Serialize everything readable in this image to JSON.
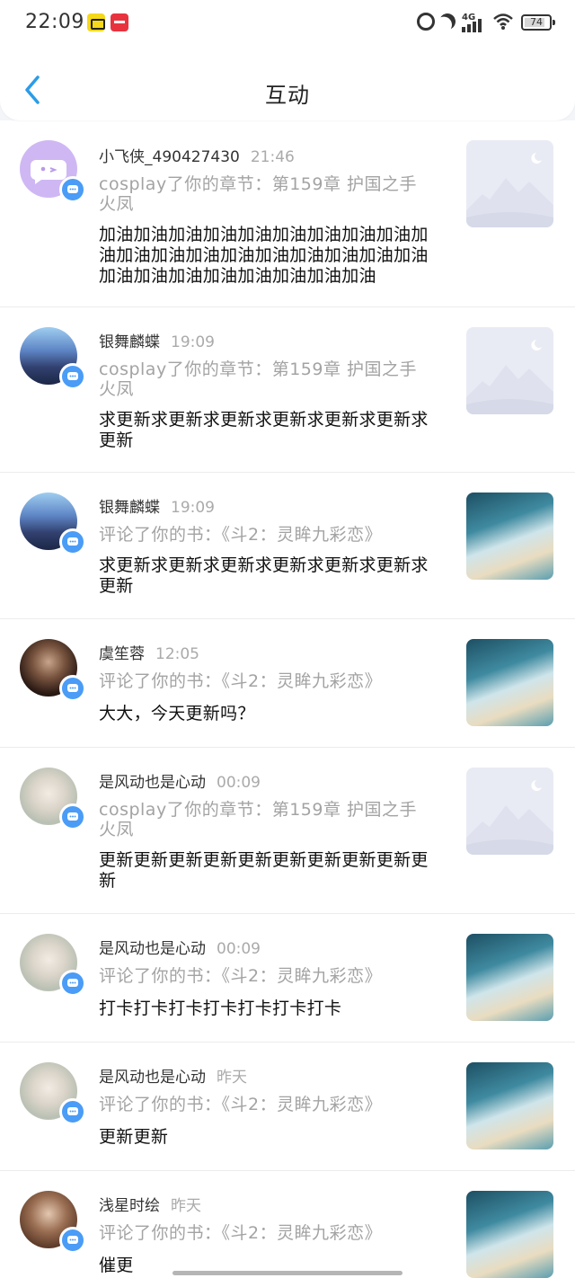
{
  "status_bar": {
    "time": "22:09",
    "network": "4G",
    "battery": "74",
    "icons": [
      "app-yellow-icon",
      "app-red-icon",
      "alarm-icon",
      "moon-icon",
      "signal-icon",
      "wifi-icon",
      "battery-icon"
    ]
  },
  "header": {
    "title": "互动",
    "back_icon": "chevron-left-icon"
  },
  "colors": {
    "accent": "#4a9cf6",
    "back": "#2b9ce8",
    "muted_text": "#a3a3a3",
    "divider": "#ececec"
  },
  "items": [
    {
      "name": "小飞侠_490427430",
      "time": "21:46",
      "action": "cosplay了你的章节：第159章 护国之手火凤",
      "comment": "加油加油加油加油加油加油加油加油加油加油加油加油加油加油加油加油加油加油加油加油加油加油加油加油加油加油加油",
      "avatar": "default-avatar",
      "thumb": "placeholder-image"
    },
    {
      "name": "银舞麟蝶",
      "time": "19:09",
      "action": "cosplay了你的章节：第159章 护国之手火凤",
      "comment": "求更新求更新求更新求更新求更新求更新求更新",
      "avatar": "photo-avatar",
      "thumb": "placeholder-image"
    },
    {
      "name": "银舞麟蝶",
      "time": "19:09",
      "action": "评论了你的书：《斗2：灵眸九彩恋》",
      "comment": "求更新求更新求更新求更新求更新求更新求更新",
      "avatar": "photo-avatar",
      "thumb": "book-cover"
    },
    {
      "name": "虞笙蓉",
      "time": "12:05",
      "action": "评论了你的书：《斗2：灵眸九彩恋》",
      "comment": "大大，今天更新吗？",
      "avatar": "photo-avatar",
      "thumb": "book-cover"
    },
    {
      "name": "是风动也是心动",
      "time": "00:09",
      "action": "cosplay了你的章节：第159章 护国之手火凤",
      "comment": "更新更新更新更新更新更新更新更新更新更新",
      "avatar": "photo-avatar",
      "thumb": "placeholder-image"
    },
    {
      "name": "是风动也是心动",
      "time": "00:09",
      "action": "评论了你的书：《斗2：灵眸九彩恋》",
      "comment": "打卡打卡打卡打卡打卡打卡打卡",
      "avatar": "photo-avatar",
      "thumb": "book-cover"
    },
    {
      "name": "是风动也是心动",
      "time": "昨天",
      "action": "评论了你的书：《斗2：灵眸九彩恋》",
      "comment": "更新更新",
      "avatar": "photo-avatar",
      "thumb": "book-cover"
    },
    {
      "name": "浅星时绘",
      "time": "昨天",
      "action": "评论了你的书：《斗2：灵眸九彩恋》",
      "comment": "催更",
      "avatar": "photo-avatar",
      "thumb": "book-cover"
    }
  ]
}
